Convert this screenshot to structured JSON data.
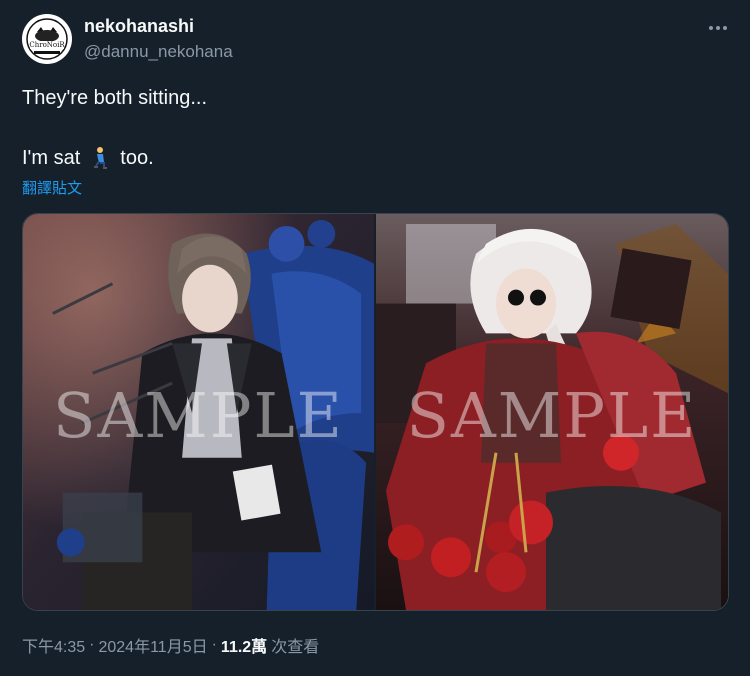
{
  "author": {
    "display_name": "nekohanashi",
    "handle": "@dannu_nekohana",
    "avatar_icon": "chronoir-logo-avatar",
    "avatar_text": "ChroNoiR"
  },
  "tweet": {
    "line1": "They're both sitting...",
    "line2_before": "I'm sat",
    "line2_emoji": "person-kneeling-emoji",
    "line2_after": "too.",
    "translate_label": "翻譯貼文"
  },
  "media": {
    "images": [
      {
        "watermark": "SAMPLE",
        "subject": "dark-haired character on blue chair"
      },
      {
        "watermark": "SAMPLE",
        "subject": "white-haired character in red with roses"
      }
    ]
  },
  "meta": {
    "time": "下午4:35",
    "date": "2024年11月5日",
    "views_count": "11.2萬",
    "views_label": "次查看",
    "separator": "·"
  },
  "colors": {
    "background": "#15202b",
    "text": "#f7f9f9",
    "secondary": "#8b98a5",
    "link": "#1d9bf0",
    "border": "#38444d"
  }
}
